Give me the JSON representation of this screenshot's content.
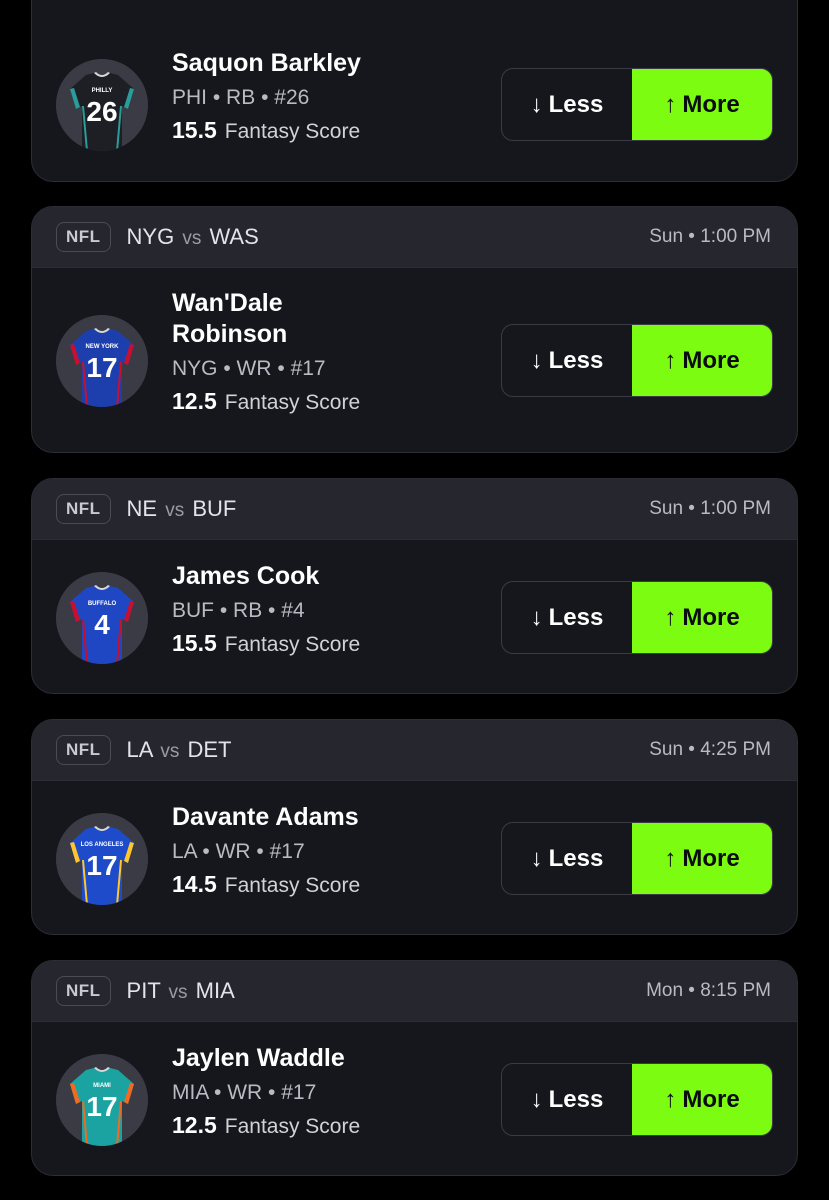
{
  "cards": [
    {
      "header": null,
      "player": {
        "name": "Saquon Barkley",
        "team": "PHI",
        "pos": "RB",
        "num": "#26",
        "line": "15.5",
        "stat": "Fantasy Score"
      },
      "jersey": {
        "number": "26",
        "city": "PHILLY",
        "body": "#1d1f24",
        "stripe": "#2a9d9b",
        "num_color": "#ffffff"
      }
    },
    {
      "header": {
        "league": "NFL",
        "home": "NYG",
        "vs": "vs",
        "away": "WAS",
        "time": "Sun • 1:00 PM"
      },
      "player": {
        "name": "Wan'Dale Robinson",
        "team": "NYG",
        "pos": "WR",
        "num": "#17",
        "line": "12.5",
        "stat": "Fantasy Score"
      },
      "jersey": {
        "number": "17",
        "city": "NEW YORK",
        "body": "#1d3fae",
        "stripe": "#c8102e",
        "num_color": "#ffffff"
      }
    },
    {
      "header": {
        "league": "NFL",
        "home": "NE",
        "vs": "vs",
        "away": "BUF",
        "time": "Sun • 1:00 PM"
      },
      "player": {
        "name": "James Cook",
        "team": "BUF",
        "pos": "RB",
        "num": "#4",
        "line": "15.5",
        "stat": "Fantasy Score"
      },
      "jersey": {
        "number": "4",
        "city": "BUFFALO",
        "body": "#1f47c4",
        "stripe": "#c8102e",
        "num_color": "#ffffff"
      }
    },
    {
      "header": {
        "league": "NFL",
        "home": "LA",
        "vs": "vs",
        "away": "DET",
        "time": "Sun • 4:25 PM"
      },
      "player": {
        "name": "Davante Adams",
        "team": "LA",
        "pos": "WR",
        "num": "#17",
        "line": "14.5",
        "stat": "Fantasy Score"
      },
      "jersey": {
        "number": "17",
        "city": "LOS ANGELES",
        "body": "#1e4bc9",
        "stripe": "#ffc72c",
        "num_color": "#ffffff"
      }
    },
    {
      "header": {
        "league": "NFL",
        "home": "PIT",
        "vs": "vs",
        "away": "MIA",
        "time": "Mon • 8:15 PM"
      },
      "player": {
        "name": "Jaylen Waddle",
        "team": "MIA",
        "pos": "WR",
        "num": "#17",
        "line": "12.5",
        "stat": "Fantasy Score"
      },
      "jersey": {
        "number": "17",
        "city": "MIAMI",
        "body": "#1aa3a0",
        "stripe": "#f26a21",
        "num_color": "#ffffff"
      }
    }
  ],
  "buttons": {
    "less": "Less",
    "more": "More",
    "less_icon": "arrow-down-icon",
    "more_icon": "arrow-up-icon"
  },
  "colors": {
    "accent": "#7cfc10",
    "card_bg": "#16171d",
    "header_bg": "#25262e"
  }
}
